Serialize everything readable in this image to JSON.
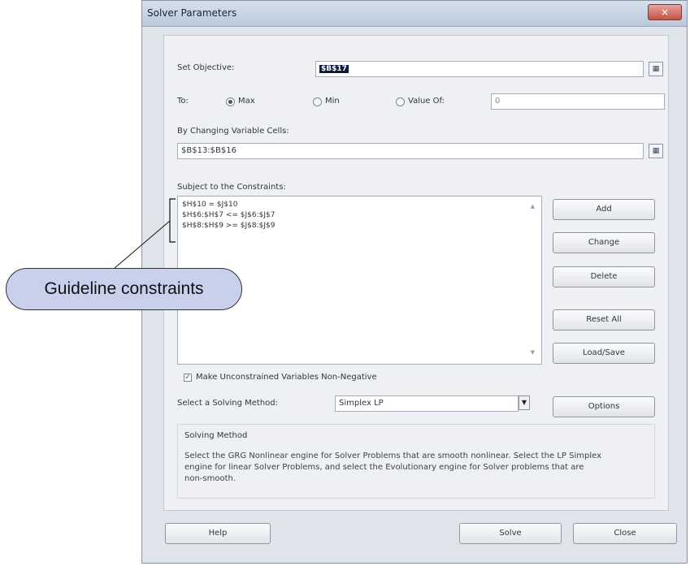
{
  "window": {
    "title": "Solver Parameters",
    "close_icon": "×"
  },
  "objective": {
    "label": "Set Objective:",
    "value": "$B$17"
  },
  "to": {
    "label": "To:",
    "max_label": "Max",
    "min_label": "Min",
    "value_of_label": "Value Of:",
    "value_of_input": "0",
    "selected": "Max"
  },
  "changing": {
    "label": "By Changing Variable Cells:",
    "value": "$B$13:$B$16"
  },
  "constraints": {
    "label": "Subject to the Constraints:",
    "items": [
      "$H$10 = $J$10",
      "$H$6:$H$7 <= $J$6:$J$7",
      "$H$8:$H$9 >= $J$8:$J$9"
    ]
  },
  "buttons": {
    "add": "Add",
    "change": "Change",
    "delete": "Delete",
    "reset_all": "Reset All",
    "load_save": "Load/Save",
    "options": "Options",
    "help": "Help",
    "solve": "Solve",
    "close": "Close"
  },
  "nonneg": {
    "label": "Make Unconstrained Variables Non-Negative",
    "checked": true
  },
  "method": {
    "label": "Select a Solving Method:",
    "value": "Simplex LP",
    "group_label": "Solving Method",
    "description_lines": [
      "Select the GRG Nonlinear engine for Solver Problems that are smooth nonlinear. Select the LP Simplex",
      "engine for linear Solver Problems, and select the Evolutionary engine for Solver problems that are",
      "non-smooth."
    ]
  },
  "annotation": {
    "label": "Guideline constraints"
  }
}
